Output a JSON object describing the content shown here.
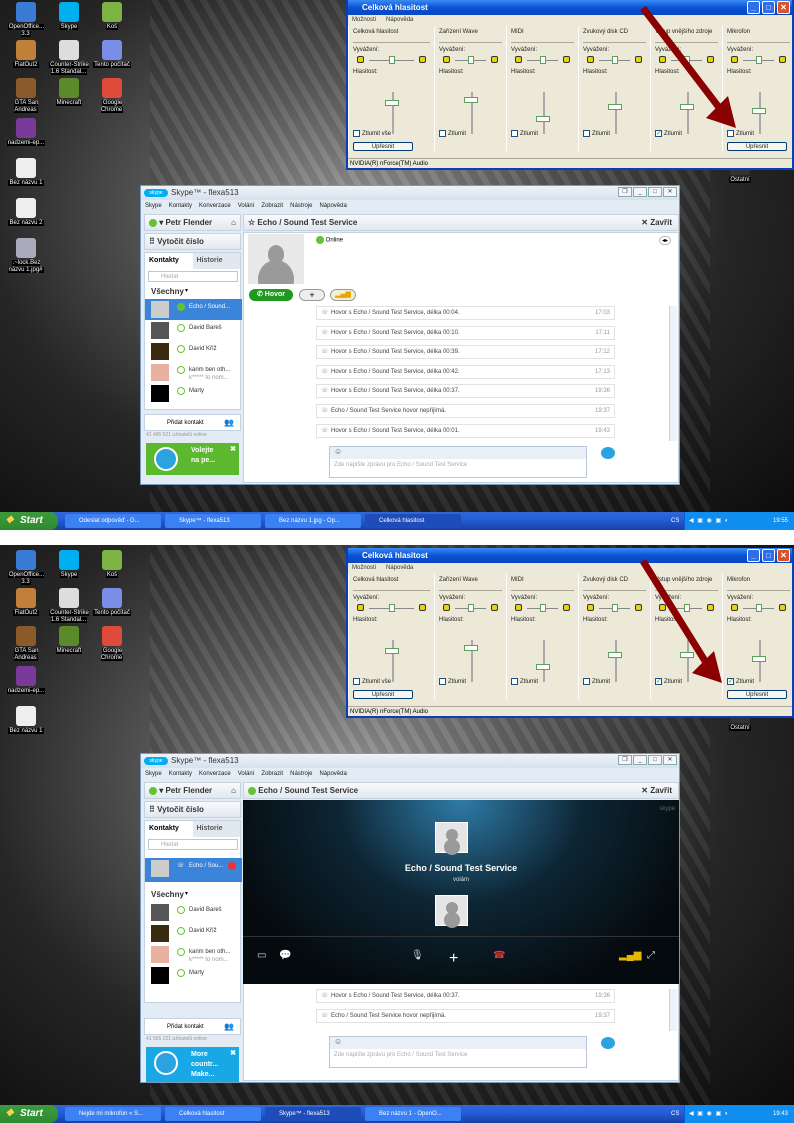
{
  "colors": {
    "xp_blue": "#0a53d6",
    "skype_blue": "#00aff0",
    "arrow": "#8b0000",
    "online_green": "#66c234",
    "selected": "#3a84da"
  },
  "screens": [
    {
      "desktop_icons": [
        "OpenOffice... 3.3",
        "Skype",
        "Koš",
        "FlatOut2",
        "Counter-Strike 1.6 Standal...",
        "Tento počítač",
        "GTA San Andreas",
        "Minecraft",
        "Google Chrome",
        "nadzemi-ep...",
        "Bez názvu 1",
        "Bez názvu 2",
        ".~lock.Bez názvu 1.jpg#"
      ],
      "desktop_icon_right": "Ostatní",
      "mixer": {
        "title": "Celková hlasitost",
        "menu": [
          "Možnosti",
          "Nápověda"
        ],
        "balance_label": "Vyvážení:",
        "volume_label": "Hlasitost:",
        "status": "NVIDIA(R) nForce(TM) Audio",
        "advanced_label": "Upřesnit",
        "channels": [
          {
            "name": "Celková hlasitost",
            "mute_label": "Ztlumit vše",
            "muted": false,
            "volume": 0.75,
            "advanced": true
          },
          {
            "name": "Zařízení Wave",
            "mute_label": "Ztlumit",
            "muted": false,
            "volume": 0.8,
            "advanced": false
          },
          {
            "name": "MIDI",
            "mute_label": "Ztlumit",
            "muted": false,
            "volume": 0.35,
            "advanced": false
          },
          {
            "name": "Zvukový disk CD",
            "mute_label": "Ztlumit",
            "muted": false,
            "volume": 0.65,
            "advanced": false
          },
          {
            "name": "Vstup vnějšího zdroje",
            "mute_label": "Ztlumit",
            "muted": true,
            "volume": 0.65,
            "advanced": false
          },
          {
            "name": "Mikrofon",
            "mute_label": "Ztlumit",
            "muted": false,
            "volume": 0.55,
            "advanced": true
          }
        ]
      },
      "skype": {
        "title": "Skype™ - flexa513",
        "menu": [
          "Skype",
          "Kontakty",
          "Konverzace",
          "Volání",
          "Zobrazit",
          "Nástroje",
          "Nápověda"
        ],
        "user": "Petr Flender",
        "dial": "Vytočit číslo",
        "tabs": [
          "Kontakty",
          "Historie"
        ],
        "search_placeholder": "Hledat",
        "group": "Všechny",
        "contacts": [
          {
            "name": "Echo / Sound...",
            "mood": "",
            "selected": true
          },
          {
            "name": "David Bareš",
            "mood": "",
            "selected": false
          },
          {
            "name": "David Kříž",
            "mood": "",
            "selected": false
          },
          {
            "name": "karim ben oth...",
            "mood": "k***** to nom...",
            "selected": false
          },
          {
            "name": "Marty",
            "mood": "",
            "selected": false
          }
        ],
        "add_contact": "Přidat kontakt",
        "online_count": "41 495 521 uživatelů online",
        "promo": [
          "Volejte",
          "na pe..."
        ],
        "conversation_title": "Echo / Sound Test Service",
        "close_label": "Zavřít",
        "status": "Online",
        "call_button": "Hovor",
        "history": [
          {
            "text": "Hovor s Echo / Sound Test Service, délka 00:04.",
            "time": "17:03"
          },
          {
            "text": "Hovor s Echo / Sound Test Service, délka 00:10.",
            "time": "17:11"
          },
          {
            "text": "Hovor s Echo / Sound Test Service, délka 00:39.",
            "time": "17:12"
          },
          {
            "text": "Hovor s Echo / Sound Test Service, délka 00:42.",
            "time": "17:13"
          },
          {
            "text": "Hovor s Echo / Sound Test Service, délka 00:37.",
            "time": "19:36"
          },
          {
            "text": "Echo / Sound Test Service hovor nepřijímá.",
            "time": "19:37"
          },
          {
            "text": "Hovor s Echo / Sound Test Service, délka 00:01.",
            "time": "19:43"
          }
        ],
        "message_placeholder": "Zde napište zprávu pro Echo / Sound Test Service"
      },
      "taskbar": {
        "start": "Start",
        "items": [
          {
            "label": "Odeslat odpověď - G...",
            "active": false
          },
          {
            "label": "Skype™ - flexa513",
            "active": false
          },
          {
            "label": "Bez názvu 1.jpg - Op...",
            "active": false
          },
          {
            "label": "Celková hlasitost",
            "active": true
          }
        ],
        "lang": "CS",
        "time": "19:55"
      }
    },
    {
      "desktop_icons": [
        "OpenOffice... 3.3",
        "Skype",
        "Koš",
        "FlatOut2",
        "Counter-Strike 1.6 Standal...",
        "Tento počítač",
        "GTA San Andreas",
        "Minecraft",
        "Google Chrome",
        "nadzemi-ep...",
        "Bez názvu 1"
      ],
      "desktop_icon_right": "Ostatní",
      "mixer": {
        "title": "Celková hlasitost",
        "menu": [
          "Možnosti",
          "Nápověda"
        ],
        "balance_label": "Vyvážení:",
        "volume_label": "Hlasitost:",
        "status": "NVIDIA(R) nForce(TM) Audio",
        "advanced_label": "Upřesnit",
        "channels": [
          {
            "name": "Celková hlasitost",
            "mute_label": "Ztlumit vše",
            "muted": false,
            "volume": 0.75,
            "advanced": true
          },
          {
            "name": "Zařízení Wave",
            "mute_label": "Ztlumit",
            "muted": false,
            "volume": 0.8,
            "advanced": false
          },
          {
            "name": "MIDI",
            "mute_label": "Ztlumit",
            "muted": false,
            "volume": 0.35,
            "advanced": false
          },
          {
            "name": "Zvukový disk CD",
            "mute_label": "Ztlumit",
            "muted": false,
            "volume": 0.65,
            "advanced": false
          },
          {
            "name": "Vstup vnějšího zdroje",
            "mute_label": "Ztlumit",
            "muted": true,
            "volume": 0.65,
            "advanced": false
          },
          {
            "name": "Mikrofon",
            "mute_label": "Ztlumit",
            "muted": true,
            "volume": 0.55,
            "advanced": true
          }
        ]
      },
      "skype": {
        "title": "Skype™ - flexa513",
        "menu": [
          "Skype",
          "Kontakty",
          "Konverzace",
          "Volání",
          "Zobrazit",
          "Nástroje",
          "Nápověda"
        ],
        "user": "Petr Flender",
        "dial": "Vytočit číslo",
        "tabs": [
          "Kontakty",
          "Historie"
        ],
        "search_placeholder": "Hledat",
        "active_call_contact": "Echo / Sou...",
        "group": "Všechny",
        "contacts": [
          {
            "name": "David Bareš",
            "mood": "",
            "selected": false
          },
          {
            "name": "David Kříž",
            "mood": "",
            "selected": false
          },
          {
            "name": "karim ben oth...",
            "mood": "k***** to nom...",
            "selected": false
          },
          {
            "name": "Marty",
            "mood": "",
            "selected": false
          }
        ],
        "add_contact": "Přidat kontakt",
        "online_count": "41 565 221 uživatelů online",
        "promo": [
          "More",
          "countr...",
          "Make..."
        ],
        "conversation_title": "Echo / Sound Test Service",
        "close_label": "Zavřít",
        "call_name": "Echo / Sound Test Service",
        "call_status": "volám",
        "history": [
          {
            "text": "Hovor s Echo / Sound Test Service, délka 00:37.",
            "time": "19:36"
          },
          {
            "text": "Echo / Sound Test Service hovor nepřijímá.",
            "time": "19:37"
          }
        ],
        "message_placeholder": "Zde napište zprávu pro Echo / Sound Test Service"
      },
      "taskbar": {
        "start": "Start",
        "items": [
          {
            "label": "Nejde mi mikrofon « S...",
            "active": false
          },
          {
            "label": "Celková hlasitost",
            "active": false
          },
          {
            "label": "Skype™ - flexa513",
            "active": true
          },
          {
            "label": "Bez názvu 1 - OpenO...",
            "active": false
          }
        ],
        "lang": "CS",
        "time": "19:43"
      }
    }
  ]
}
